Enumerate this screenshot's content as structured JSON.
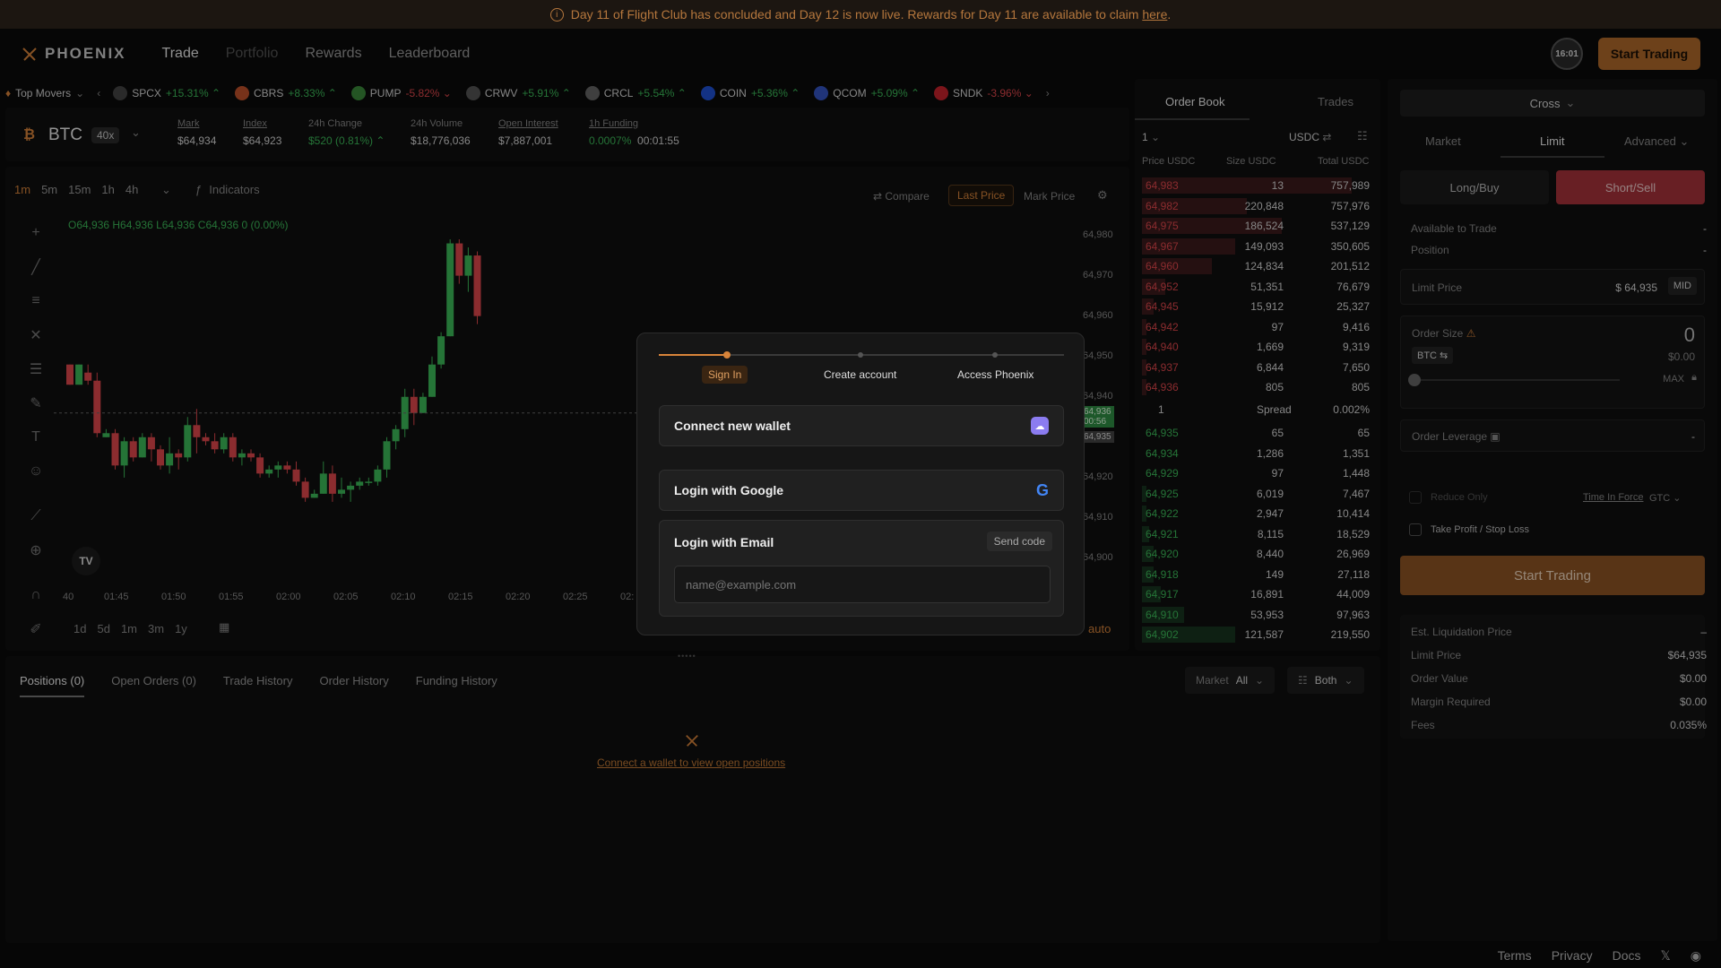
{
  "announcement": {
    "prefix": "Day 11 of Flight Club has concluded and Day 12 is now live. Rewards for Day 11 are available to claim ",
    "link": "here",
    "suffix": "."
  },
  "nav": {
    "brand": "PHOENIX",
    "links": [
      "Trade",
      "Portfolio",
      "Rewards",
      "Leaderboard"
    ],
    "avatar": "16:01",
    "start_trading": "Start Trading"
  },
  "ticker": {
    "label": "Top Movers",
    "items": [
      {
        "sym": "SPCX",
        "chg": "+15.31%",
        "dir": "up",
        "color": "#444"
      },
      {
        "sym": "CBRS",
        "chg": "+8.33%",
        "dir": "up",
        "color": "#c0522a"
      },
      {
        "sym": "PUMP",
        "chg": "-5.82%",
        "dir": "down",
        "color": "#3a8a3a"
      },
      {
        "sym": "CRWV",
        "chg": "+5.91%",
        "dir": "up",
        "color": "#555"
      },
      {
        "sym": "CRCL",
        "chg": "+5.54%",
        "dir": "up",
        "color": "#666"
      },
      {
        "sym": "COIN",
        "chg": "+5.36%",
        "dir": "up",
        "color": "#1f52d6"
      },
      {
        "sym": "QCOM",
        "chg": "+5.09%",
        "dir": "up",
        "color": "#3455c4"
      },
      {
        "sym": "SNDK",
        "chg": "-3.96%",
        "dir": "down",
        "color": "#c8232c"
      }
    ]
  },
  "market": {
    "symbol": "BTC",
    "leverage": "40x",
    "stats": [
      {
        "label": "Mark",
        "value": "$64,934"
      },
      {
        "label": "Index",
        "value": "$64,923"
      },
      {
        "label": "24h Change",
        "value": "$520 (0.81%)"
      },
      {
        "label": "24h Volume",
        "value": "$18,776,036"
      },
      {
        "label": "Open Interest",
        "value": "$7,887,001"
      },
      {
        "label": "1h Funding",
        "value": "0.0007%",
        "extra": "00:01:55"
      }
    ]
  },
  "chart_toolbar": {
    "intervals": [
      "1m",
      "5m",
      "15m",
      "1h",
      "4h"
    ],
    "indicators": "Indicators",
    "compare": "Compare",
    "last_price": "Last Price",
    "mark_price": "Mark Price"
  },
  "chart": {
    "ohlc": "O64,936 H64,936 L64,936 C64,936 0 (0.00%)",
    "ranges": [
      "1d",
      "5d",
      "1m",
      "3m",
      "1y"
    ],
    "auto": "auto"
  },
  "chart_data": {
    "type": "candlestick",
    "symbol": "BTC",
    "interval": "1m",
    "yticks": [
      "64,980",
      "64,970",
      "64,960",
      "64,950",
      "64,940",
      "64,920",
      "64,910",
      "64,900"
    ],
    "xticks": [
      "40",
      "01:45",
      "01:50",
      "01:55",
      "02:00",
      "02:05",
      "02:10",
      "02:15",
      "02:20",
      "02:25",
      "02:"
    ],
    "price_label": "64,936",
    "price_sub": "00:56",
    "mark_label": "64,935",
    "candles": [
      [
        64948,
        64948,
        64943,
        64943
      ],
      [
        64943,
        64948,
        64943,
        64948
      ],
      [
        64946,
        64948,
        64943,
        64944
      ],
      [
        64944,
        64946,
        64930,
        64931
      ],
      [
        64930,
        64932,
        64930,
        64931
      ],
      [
        64931,
        64932,
        64922,
        64923
      ],
      [
        64923,
        64930,
        64920,
        64929
      ],
      [
        64929,
        64930,
        64924,
        64925
      ],
      [
        64925,
        64931,
        64925,
        64930
      ],
      [
        64930,
        64931,
        64924,
        64927
      ],
      [
        64927,
        64928,
        64922,
        64923
      ],
      [
        64923,
        64930,
        64921,
        64926
      ],
      [
        64926,
        64927,
        64922,
        64925
      ],
      [
        64925,
        64935,
        64924,
        64933
      ],
      [
        64933,
        64937,
        64926,
        64930
      ],
      [
        64930,
        64931,
        64928,
        64929
      ],
      [
        64929,
        64931,
        64926,
        64927
      ],
      [
        64927,
        64931,
        64926,
        64930
      ],
      [
        64930,
        64931,
        64924,
        64925
      ],
      [
        64925,
        64927,
        64923,
        64926
      ],
      [
        64926,
        64927,
        64924,
        64925
      ],
      [
        64925,
        64926,
        64920,
        64921
      ],
      [
        64921,
        64923,
        64920,
        64922
      ],
      [
        64922,
        64924,
        64920,
        64923
      ],
      [
        64923,
        64924,
        64921,
        64922
      ],
      [
        64922,
        64924,
        64918,
        64919
      ],
      [
        64919,
        64920,
        64914,
        64915
      ],
      [
        64915,
        64917,
        64915,
        64916
      ],
      [
        64916,
        64924,
        64916,
        64921
      ],
      [
        64921,
        64923,
        64914,
        64916
      ],
      [
        64916,
        64920,
        64915,
        64917
      ],
      [
        64917,
        64919,
        64914,
        64918
      ],
      [
        64918,
        64920,
        64917,
        64919
      ],
      [
        64919,
        64920,
        64918,
        64919
      ],
      [
        64919,
        64923,
        64918,
        64922
      ],
      [
        64922,
        64930,
        64920,
        64929
      ],
      [
        64929,
        64933,
        64927,
        64932
      ],
      [
        64932,
        64942,
        64930,
        64940
      ],
      [
        64940,
        64942,
        64933,
        64936
      ],
      [
        64936,
        64941,
        64936,
        64940
      ],
      [
        64940,
        64950,
        64940,
        64948
      ],
      [
        64948,
        64956,
        64947,
        64955
      ],
      [
        64955,
        64979,
        64955,
        64978
      ],
      [
        64978,
        64979,
        64968,
        64970
      ],
      [
        64970,
        64977,
        64966,
        64975
      ],
      [
        64975,
        64976,
        64958,
        64960
      ]
    ]
  },
  "orderbook": {
    "tabs": [
      "Order Book",
      "Trades"
    ],
    "grouping": "1",
    "unit": "USDC",
    "headers": [
      "Price USDC",
      "Size USDC",
      "Total USDC"
    ],
    "asks": [
      [
        "64,983",
        "13",
        "757,989",
        0.9
      ],
      [
        "64,982",
        "220,848",
        "757,976",
        0.45
      ],
      [
        "64,975",
        "186,524",
        "537,129",
        0.6
      ],
      [
        "64,967",
        "149,093",
        "350,605",
        0.4
      ],
      [
        "64,960",
        "124,834",
        "201,512",
        0.3
      ],
      [
        "64,952",
        "51,351",
        "76,679",
        0.1
      ],
      [
        "64,945",
        "15,912",
        "25,327",
        0.05
      ],
      [
        "64,942",
        "97",
        "9,416",
        0.02
      ],
      [
        "64,940",
        "1,669",
        "9,319",
        0.02
      ],
      [
        "64,937",
        "6,844",
        "7,650",
        0.02
      ],
      [
        "64,936",
        "805",
        "805",
        0.02
      ]
    ],
    "spread": {
      "value": "1",
      "label": "Spread",
      "pct": "0.002%"
    },
    "bids": [
      [
        "64,935",
        "65",
        "65",
        0.0
      ],
      [
        "64,934",
        "1,286",
        "1,351",
        0.0
      ],
      [
        "64,929",
        "97",
        "1,448",
        0.0
      ],
      [
        "64,925",
        "6,019",
        "7,467",
        0.02
      ],
      [
        "64,922",
        "2,947",
        "10,414",
        0.02
      ],
      [
        "64,921",
        "8,115",
        "18,529",
        0.03
      ],
      [
        "64,920",
        "8,440",
        "26,969",
        0.05
      ],
      [
        "64,918",
        "149",
        "27,118",
        0.05
      ],
      [
        "64,917",
        "16,891",
        "44,009",
        0.08
      ],
      [
        "64,910",
        "53,953",
        "97,963",
        0.18
      ],
      [
        "64,902",
        "121,587",
        "219,550",
        0.4
      ]
    ]
  },
  "order_form": {
    "margin_mode": "Cross",
    "types": [
      "Market",
      "Limit",
      "Advanced"
    ],
    "sides": [
      "Long/Buy",
      "Short/Sell"
    ],
    "available_label": "Available to Trade",
    "available_value": "-",
    "position_label": "Position",
    "position_value": "-",
    "limit_price_label": "Limit Price",
    "limit_price_value": "$ 64,935",
    "mid": "MID",
    "order_size_label": "Order Size",
    "order_size_value": "0",
    "size_unit": "BTC",
    "size_usd": "$0.00",
    "max": "MAX",
    "leverage_label": "Order Leverage",
    "leverage_value": "-",
    "reduce_only": "Reduce Only",
    "tif_label": "Time In Force",
    "tif_value": "GTC",
    "tpsl": "Take Profit / Stop Loss",
    "submit": "Start Trading",
    "summary": [
      [
        "Est. Liquidation Price",
        "–"
      ],
      [
        "Limit Price",
        "$64,935"
      ],
      [
        "Order Value",
        "$0.00"
      ],
      [
        "Margin Required",
        "$0.00"
      ],
      [
        "Fees",
        "0.035%"
      ]
    ]
  },
  "bottom": {
    "tabs": [
      "Positions (0)",
      "Open Orders (0)",
      "Trade History",
      "Order History",
      "Funding History"
    ],
    "market_label": "Market",
    "market_value": "All",
    "both": "Both",
    "empty_link": "Connect a wallet to view open positions"
  },
  "modal": {
    "steps": [
      "Sign In",
      "Create account",
      "Access Phoenix"
    ],
    "wallet": "Connect new wallet",
    "google": "Login with Google",
    "email": "Login with Email",
    "send_code": "Send code",
    "email_placeholder": "name@example.com"
  },
  "footer": {
    "links": [
      "Terms",
      "Privacy",
      "Docs"
    ]
  },
  "colors": {
    "accent": "#b06a2a",
    "green": "#3dbb5a",
    "red": "#e0474c"
  }
}
